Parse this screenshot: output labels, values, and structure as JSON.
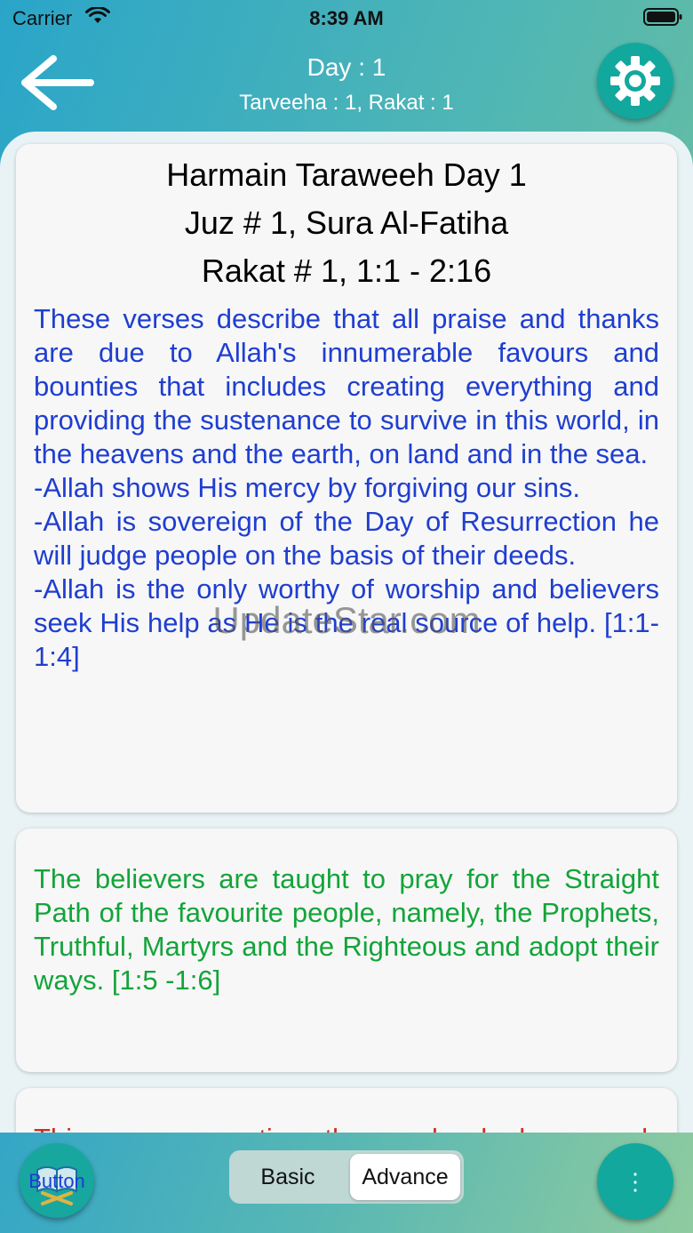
{
  "status_bar": {
    "carrier": "Carrier",
    "time": "8:39 AM"
  },
  "header": {
    "title": "Day : 1",
    "subtitle": "Tarveeha : 1, Rakat : 1",
    "back_icon": "back-arrow-icon",
    "settings_icon": "gear-icon"
  },
  "cards": {
    "card1": {
      "heading_line1": "Harmain Taraweeh Day 1",
      "heading_line2": "Juz # 1, Sura Al-Fatiha",
      "heading_line3": "Rakat # 1,  1:1 - 2:16",
      "paragraph1": "These verses describe that all praise and thanks are due to Allah's innumerable favours and bounties that includes creating everything and providing the sustenance to survive in this world, in the heavens and the earth, on land and in the sea.",
      "paragraph2": "-Allah shows His mercy by forgiving our sins.",
      "paragraph3": "-Allah is sovereign of the Day of Resurrection he will judge people on the basis of their deeds.",
      "paragraph4": "-Allah is the only worthy of worship and believers seek His help as He is the real source of help. [1:1-1:4]"
    },
    "card2": {
      "paragraph": "The believers are taught to pray for the Straight Path of the favourite people, namely, the Prophets, Truthful, Martyrs and the Righteous and adopt their ways. [1:5 -1:6]"
    },
    "card3": {
      "paragraph": "This passage mentions the people who have good"
    }
  },
  "watermark": "UpdateStar.com",
  "bottom_bar": {
    "book_button_label": "Button",
    "segments": [
      "Basic",
      "Advance"
    ],
    "selected_segment": "Advance",
    "more_label": "⋮"
  },
  "colors": {
    "text_blue": "#1f3ed0",
    "text_green": "#13a43a",
    "text_red": "#d52a1d",
    "accent_teal": "#12a89e"
  }
}
